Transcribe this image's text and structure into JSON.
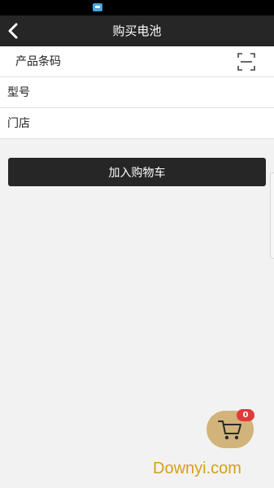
{
  "status_bar": {
    "app_icon": "notification-app-icon"
  },
  "nav": {
    "title": "购买电池",
    "back_icon": "chevron-left-icon"
  },
  "form": {
    "barcode": {
      "placeholder": "产品条码",
      "value": ""
    },
    "scan_icon": "scan-frame-icon",
    "model": {
      "placeholder": "型号",
      "value": ""
    },
    "store": {
      "placeholder": "门店",
      "value": ""
    }
  },
  "actions": {
    "add_to_cart": "加入购物车"
  },
  "cart": {
    "icon": "shopping-cart-icon",
    "badge_count": "0"
  },
  "watermark": "Downyi.com",
  "colors": {
    "nav_bg": "#262626",
    "page_bg": "#f2f2f2",
    "cart_fab": "#d2b37a",
    "badge": "#e03a3a",
    "watermark": "#d4a017"
  }
}
